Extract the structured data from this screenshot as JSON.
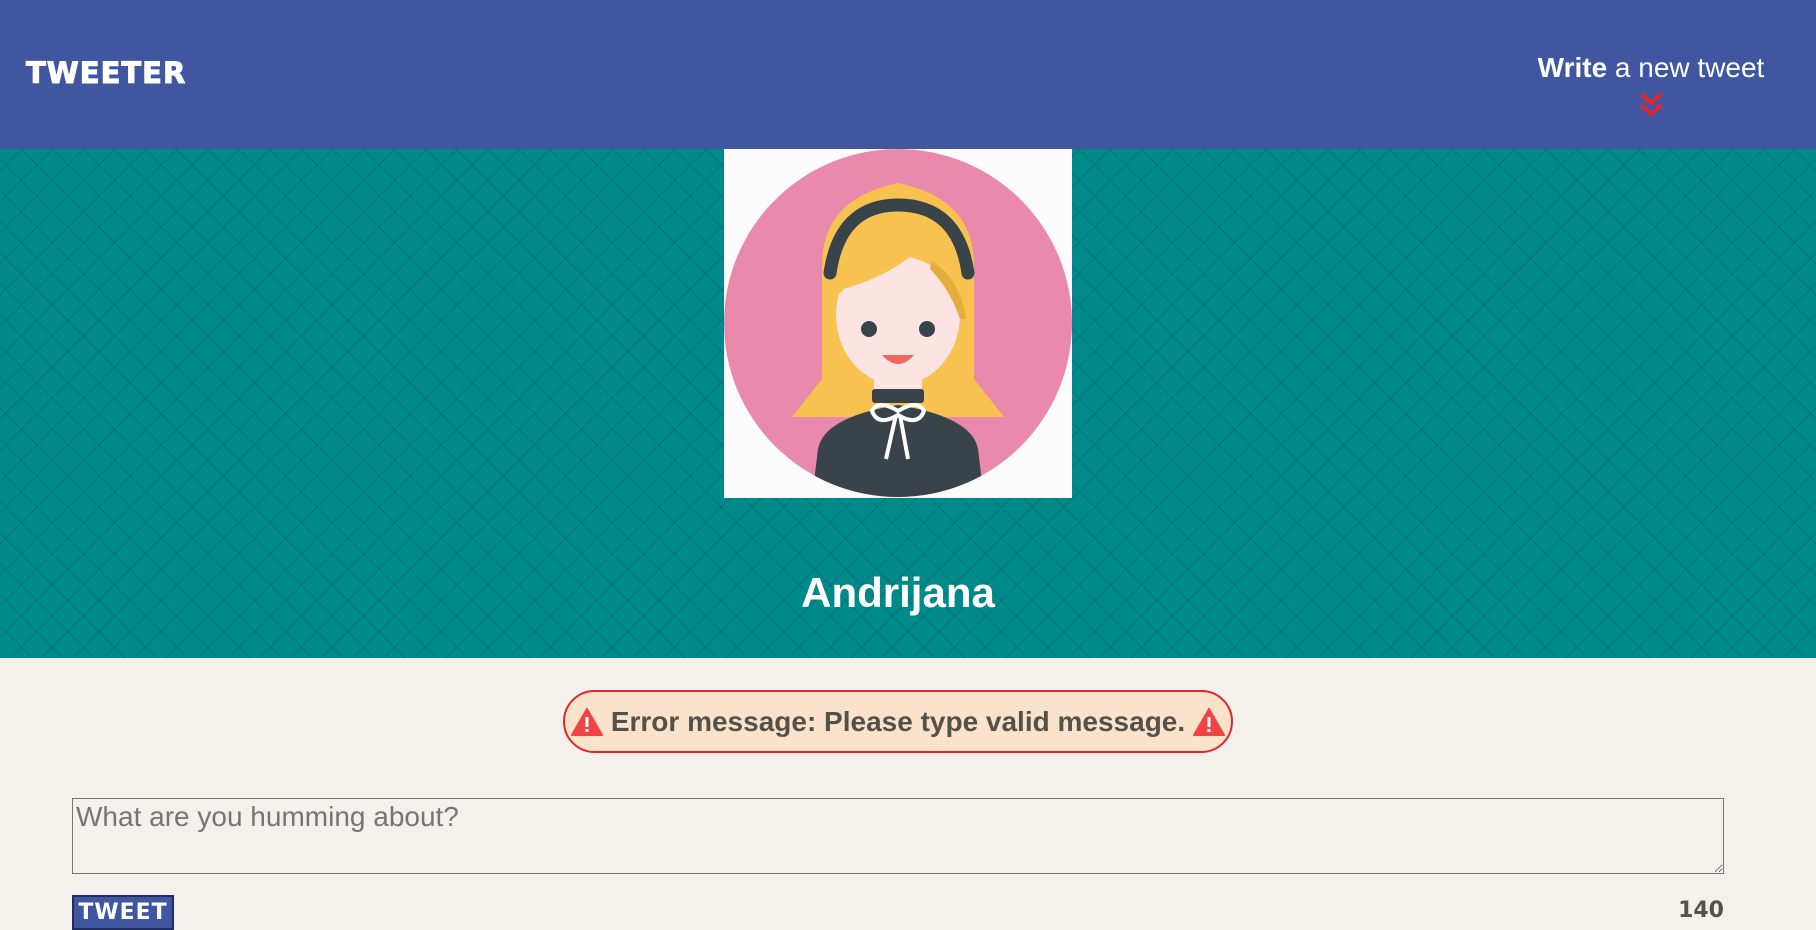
{
  "nav": {
    "brand": "TWEETER",
    "compose_strong": "Write",
    "compose_rest": " a new tweet",
    "compose_icon": "double-chevron-down-icon",
    "chevron_color": "#e0252b"
  },
  "profile": {
    "avatar_icon": "girl-avatar-icon",
    "name": "Andrijana"
  },
  "error": {
    "text": "Error message: Please type valid message.",
    "icon": "warning-icon"
  },
  "compose": {
    "placeholder": "What are you humming about?",
    "button_label": "TWEET",
    "counter": "140"
  },
  "colors": {
    "nav_bg": "#4056a1",
    "profile_bg": "#008a8a",
    "page_bg": "#f4f1ec",
    "error_border": "#e0252b",
    "error_bg": "#fbe2cb"
  }
}
